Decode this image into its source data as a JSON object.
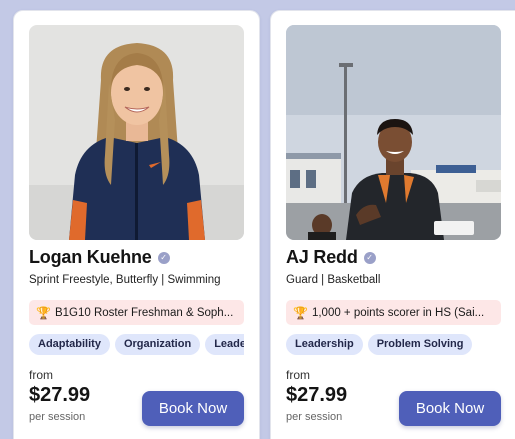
{
  "cards": [
    {
      "name": "Logan Kuehne",
      "subtitle": "Sprint Freestyle, Butterfly | Swimming",
      "achievement": "B1G10 Roster Freshman & Soph...",
      "achievement_icon": "trophy-icon",
      "tags": [
        "Adaptability",
        "Organization",
        "Leadership"
      ],
      "price_prefix": "from",
      "price": "$27.99",
      "price_suffix": "per session",
      "button": "Book Now"
    },
    {
      "name": "AJ Redd",
      "subtitle": "Guard | Basketball",
      "achievement": "1,000 + points scorer in HS (Sai...",
      "achievement_icon": "trophy-icon",
      "tags": [
        "Leadership",
        "Problem Solving"
      ],
      "price_prefix": "from",
      "price": "$27.99",
      "price_suffix": "per session",
      "button": "Book Now"
    }
  ],
  "colors": {
    "background": "#c3c9e6",
    "button": "#4f5fb9",
    "tag": "#dfe6fb",
    "achievement": "#fde7e7",
    "verified_badge": "#9aa0c8"
  }
}
